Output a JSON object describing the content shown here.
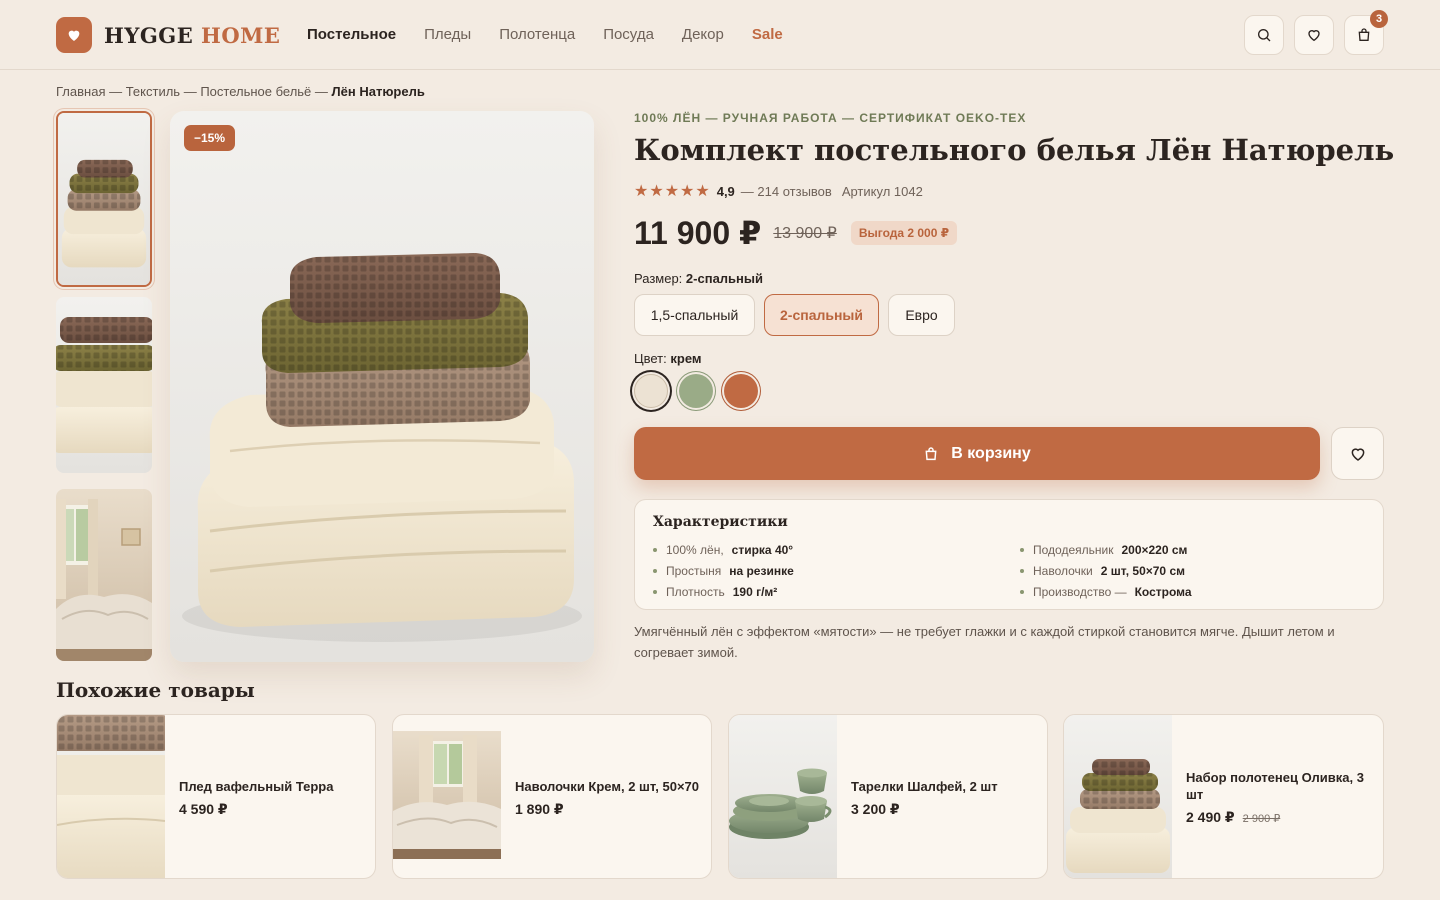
{
  "brand": {
    "name_part1": "HYGGE",
    "name_part2": "HOME"
  },
  "nav": [
    {
      "label": "Постельное"
    },
    {
      "label": "Пледы"
    },
    {
      "label": "Полотенца"
    },
    {
      "label": "Посуда"
    },
    {
      "label": "Декор"
    },
    {
      "label": "Sale"
    }
  ],
  "header": {
    "cart_count": "3"
  },
  "breadcrumb": {
    "items": [
      "Главная",
      "Текстиль",
      "Постельное бельё"
    ],
    "separator": " — ",
    "current": "Лён Натюрель"
  },
  "gallery": {
    "discount_badge": "−15%"
  },
  "product": {
    "eyebrow": "100% ЛЁН — РУЧНАЯ РАБОТА — СЕРТИФИКАТ OEKO-TEX",
    "title": "Комплект постельного белья Лён Натюрель",
    "stars": "★★★★★",
    "rating": "4,9",
    "reviews": "— 214 отзывов",
    "sku": "Артикул 1042",
    "price": "11 900 ₽",
    "old_price": "13 900 ₽",
    "saving": "Выгода 2 000 ₽",
    "size_label": "Размер:",
    "size_value": "2-спальный",
    "sizes": [
      "1,5-спальный",
      "2-спальный",
      "Евро"
    ],
    "color_label": "Цвет:",
    "color_value": "крем",
    "colors": [
      "#ece2d3",
      "#9aab87",
      "#c06a43"
    ],
    "add_to_cart": "В корзину",
    "specs_title": "Характеристики",
    "specs_left": [
      {
        "k": "100% лён,",
        "v": "стирка 40°"
      },
      {
        "k": "Простыня",
        "v": "на резинке"
      },
      {
        "k": "Плотность",
        "v": "190 г/м²"
      }
    ],
    "specs_right": [
      {
        "k": "Пододеяльник",
        "v": "200×220 см"
      },
      {
        "k": "Наволочки",
        "v": "2 шт, 50×70 см"
      },
      {
        "k": "Производство —",
        "v": "Кострома"
      }
    ],
    "description": "Умягчённый лён с эффектом «мятости» — не требует глажки и с каждой стиркой становится мягче. Дышит летом и согревает зимой."
  },
  "similar": {
    "title": "Похожие товары",
    "items": [
      {
        "name": "Плед вафельный Терра",
        "price": "4 590 ₽",
        "old_price": ""
      },
      {
        "name": "Наволочки Крем, 2 шт, 50×70",
        "price": "1 890 ₽",
        "old_price": ""
      },
      {
        "name": "Тарелки Шалфей, 2 шт",
        "price": "3 200 ₽",
        "old_price": ""
      },
      {
        "name": "Набор полотенец Оливка, 3 шт",
        "price": "2 490 ₽",
        "old_price": "2 900 ₽"
      }
    ]
  },
  "icons": [
    "heart-icon",
    "search-icon",
    "bag-icon",
    "star-icon"
  ],
  "colors": {
    "accent": "#c06a43",
    "background": "#f3ebe2",
    "olive": "#6f7a56"
  }
}
